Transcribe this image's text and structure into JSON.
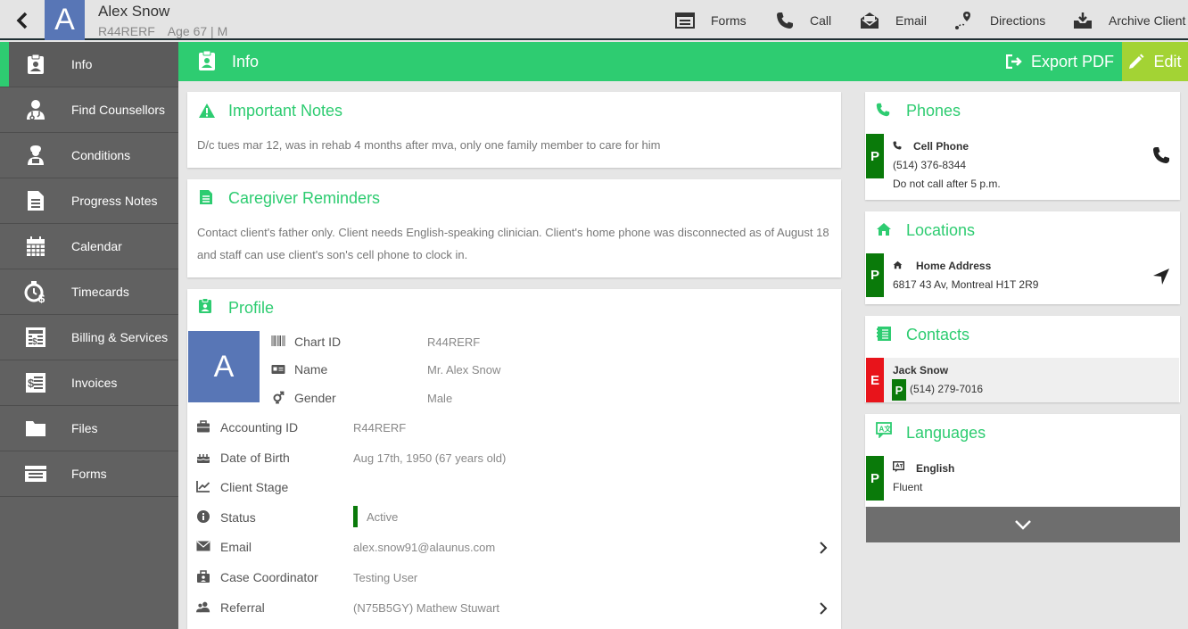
{
  "header": {
    "avatar_letter": "A",
    "client_name": "Alex Snow",
    "chart_id": "R44RERF",
    "age_sex": "Age 67 | M",
    "actions": {
      "forms": "Forms",
      "call": "Call",
      "email": "Email",
      "directions": "Directions",
      "archive": "Archive Client"
    }
  },
  "sidebar": {
    "items": [
      {
        "label": "Info",
        "icon": "clipboard-id-icon"
      },
      {
        "label": "Find Counsellors",
        "icon": "doctor-icon"
      },
      {
        "label": "Conditions",
        "icon": "patient-icon"
      },
      {
        "label": "Progress Notes",
        "icon": "document-icon"
      },
      {
        "label": "Calendar",
        "icon": "calendar-icon"
      },
      {
        "label": "Timecards",
        "icon": "clock-dollar-icon"
      },
      {
        "label": "Billing & Services",
        "icon": "billing-icon"
      },
      {
        "label": "Invoices",
        "icon": "invoice-icon"
      },
      {
        "label": "Files",
        "icon": "folder-icon"
      },
      {
        "label": "Forms",
        "icon": "form-icon"
      }
    ]
  },
  "page": {
    "title": "Info",
    "export_label": "Export PDF",
    "edit_label": "Edit"
  },
  "important_notes": {
    "title": "Important Notes",
    "text": "D/c tues mar 12, was in rehab 4 months after mva, only one family member to care for him"
  },
  "caregiver_reminders": {
    "title": "Caregiver Reminders",
    "line1": "Contact client's father only. Client needs English-speaking clinician. Client's home phone was disconnected as of August 18",
    "line2": "and staff can use client's son's cell phone to clock in."
  },
  "profile": {
    "title": "Profile",
    "avatar_letter": "A",
    "chart_id_label": "Chart ID",
    "chart_id": "R44RERF",
    "name_label": "Name",
    "name": "Mr. Alex Snow",
    "gender_label": "Gender",
    "gender": "Male",
    "accounting_id_label": "Accounting ID",
    "accounting_id": "R44RERF",
    "dob_label": "Date of Birth",
    "dob": "Aug 17th, 1950 (67 years old)",
    "client_stage_label": "Client Stage",
    "client_stage": "",
    "status_label": "Status",
    "status": "Active",
    "email_label": "Email",
    "email": "alex.snow91@alaunus.com",
    "case_coordinator_label": "Case Coordinator",
    "case_coordinator": "Testing User",
    "referral_label": "Referral",
    "referral": "(N75B5GY) Mathew Stuwart"
  },
  "phones": {
    "title": "Phones",
    "badge": "P",
    "type": "Cell Phone",
    "number": "(514) 376-8344",
    "note": "Do not call after 5 p.m."
  },
  "locations": {
    "title": "Locations",
    "badge": "P",
    "type": "Home Address",
    "address": "6817 43 Av, Montreal H1T 2R9"
  },
  "contacts": {
    "title": "Contacts",
    "badge": "E",
    "name": "Jack Snow",
    "phone_badge": "P",
    "phone": "(514) 279-7016"
  },
  "languages": {
    "title": "Languages",
    "badge": "P",
    "language": "English",
    "level": "Fluent"
  },
  "colors": {
    "accent": "#2ecc71",
    "edit": "#a3d334",
    "sidebar": "#616161",
    "avatar": "#5876b6",
    "badge_primary": "#0a7a0a",
    "badge_emergency": "#e8141b"
  }
}
